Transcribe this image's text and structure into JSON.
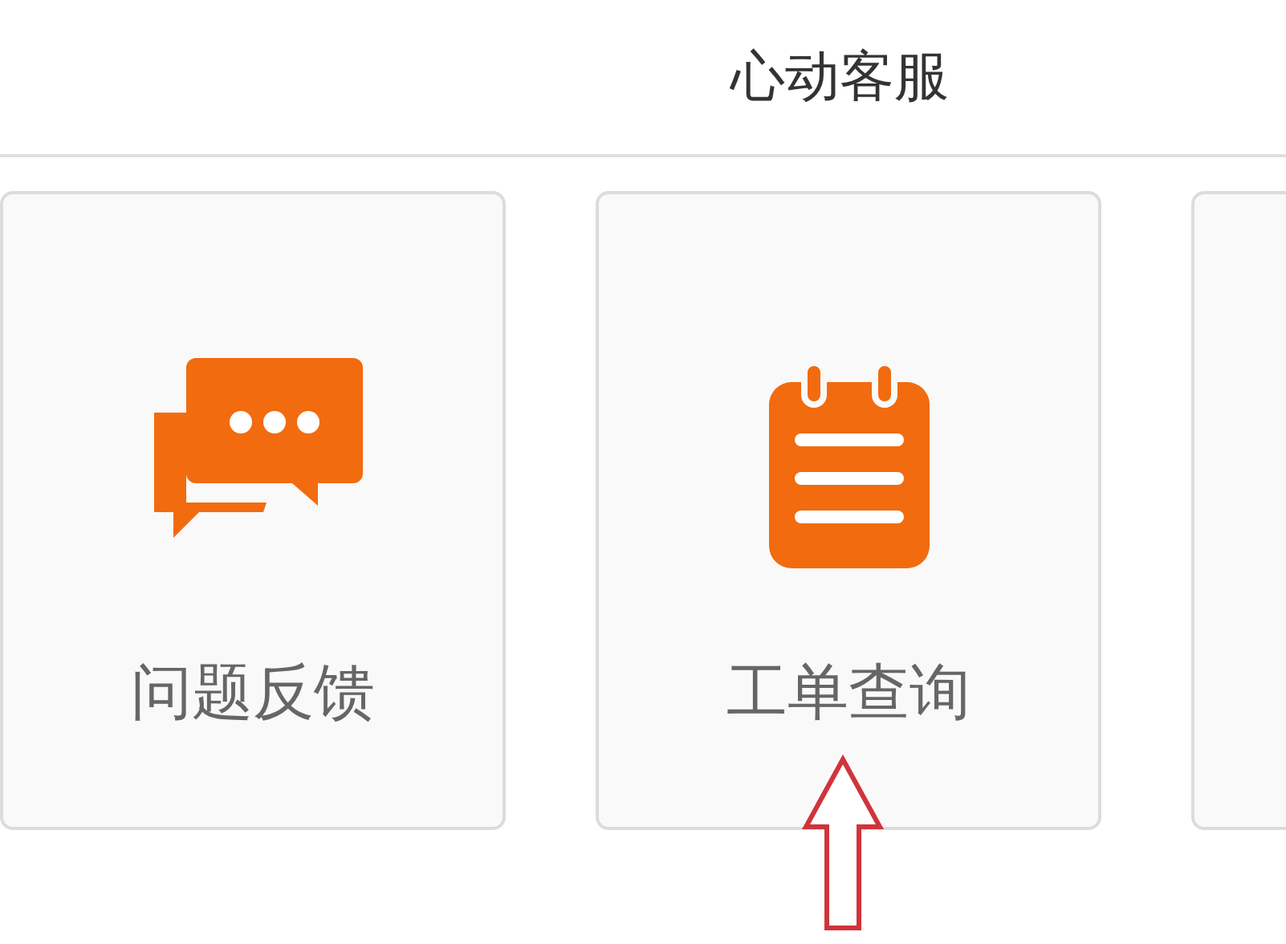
{
  "header": {
    "title": "心动客服"
  },
  "cards": [
    {
      "kind": "chat",
      "label": "问题反馈"
    },
    {
      "kind": "notepad",
      "label": "工单查询"
    }
  ]
}
